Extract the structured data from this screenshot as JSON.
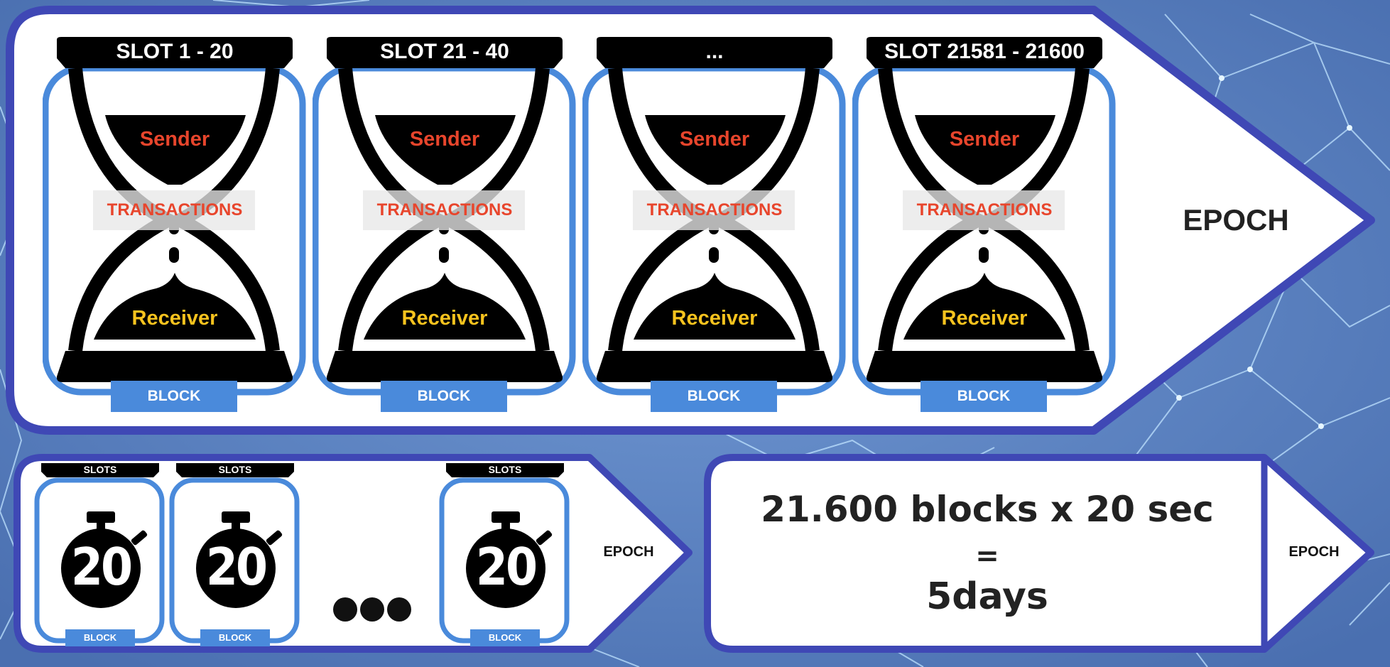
{
  "colors": {
    "background": "#5e86c4",
    "frame": "#3f48b5",
    "slot_outline": "#4a8adb",
    "sender_text": "#e8452c",
    "receiver_text": "#f7c31e",
    "hourglass": "#000000"
  },
  "top_panel": {
    "slots": [
      {
        "header": "SLOT    1 - 20",
        "sender": "Sender",
        "transactions": "TRANSACTIONS",
        "receiver": "Receiver",
        "block": "BLOCK"
      },
      {
        "header": "SLOT    21 - 40",
        "sender": "Sender",
        "transactions": "TRANSACTIONS",
        "receiver": "Receiver",
        "block": "BLOCK"
      },
      {
        "header": "...",
        "sender": "Sender",
        "transactions": "TRANSACTIONS",
        "receiver": "Receiver",
        "block": "BLOCK"
      },
      {
        "header": "SLOT  21581 - 21600",
        "sender": "Sender",
        "transactions": "TRANSACTIONS",
        "receiver": "Receiver",
        "block": "BLOCK"
      }
    ],
    "epoch_label": "EPOCH"
  },
  "bottom_left_panel": {
    "slots": [
      {
        "header": "SLOTS",
        "timer": "20",
        "block": "BLOCK"
      },
      {
        "header": "SLOTS",
        "timer": "20",
        "block": "BLOCK"
      },
      {
        "header": "SLOTS",
        "timer": "20",
        "block": "BLOCK"
      }
    ],
    "ellipsis_icon": "three-dots-icon",
    "timer_icon": "stopwatch-icon",
    "epoch_label": "EPOCH"
  },
  "bottom_right_panel": {
    "line1": "21.600 blocks x 20 sec",
    "line2": "=",
    "line3": "5days",
    "epoch_label": "EPOCH"
  }
}
